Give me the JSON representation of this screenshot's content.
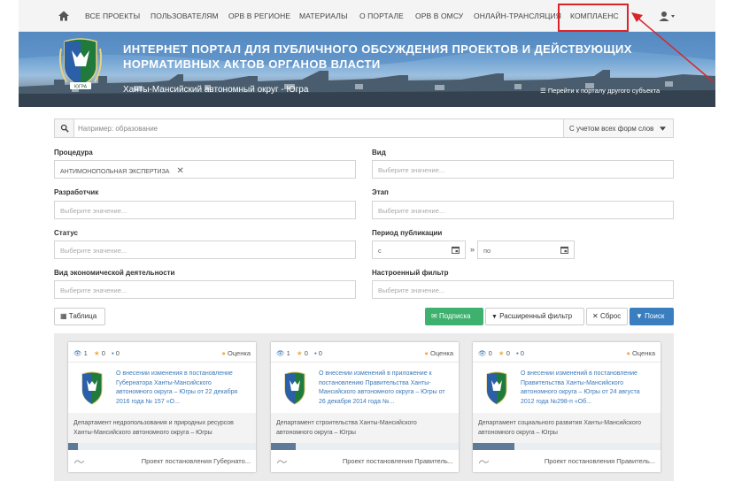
{
  "nav": {
    "home_icon": "home-icon",
    "items": [
      "ВСЕ ПРОЕКТЫ",
      "ПОЛЬЗОВАТЕЛЯМ",
      "ОРВ В РЕГИОНЕ",
      "МАТЕРИАЛЫ",
      "О ПОРТАЛЕ",
      "ОРВ В ОМСУ",
      "ОНЛАЙН-ТРАНСЛЯЦИЯ",
      "КОМПЛАЕНС"
    ],
    "user_icon": "user-icon"
  },
  "banner": {
    "title": "ИНТЕРНЕТ ПОРТАЛ ДЛЯ ПУБЛИЧНОГО ОБСУЖДЕНИЯ ПРОЕКТОВ И ДЕЙСТВУЮЩИХ НОРМАТИВНЫХ АКТОВ ОРГАНОВ ВЛАСТИ",
    "subtitle": "Ханты-Мансийский автономный округ - Югра",
    "link": "Перейти к порталу другого субъекта",
    "logo_text": "ЮГРА"
  },
  "search": {
    "placeholder": "Например: образование",
    "mode": "С учетом всех форм слов"
  },
  "filters": {
    "procedure_label": "Процедура",
    "procedure_tag": "АНТИМОНОПОЛЬНАЯ ЭКСПЕРТИЗА",
    "kind_label": "Вид",
    "developer_label": "Разработчик",
    "stage_label": "Этап",
    "status_label": "Статус",
    "period_label": "Период публикации",
    "date_from": "с",
    "date_to": "по",
    "activity_label": "Вид экономической деятельности",
    "custom_filter_label": "Настроенный фильтр",
    "placeholder": "Выберите значение..."
  },
  "buttons": {
    "table": "Таблица",
    "subscribe": "Подписка",
    "advanced": "Расширенный фильтр",
    "reset": "Сброс",
    "search": "Поиск"
  },
  "colors": {
    "subscribe": "#3fb16f",
    "search": "#3a7ebf",
    "highlight": "#d9252a",
    "link": "#3b78b9"
  },
  "cards": [
    {
      "views": "1",
      "stars": "0",
      "comments": "0",
      "rating": "Оценка",
      "title": "О внесении изменения в постановление Губернатора Ханты-Мансийского автономного округа – Югры от 22 декабря 2016 года № 157 «О...",
      "dept": "Департамент недропользования и природных ресурсов Ханты-Мансийского автономного округа – Югры",
      "progress": 0.05,
      "type": "Проект постановления Губернато..."
    },
    {
      "views": "1",
      "stars": "0",
      "comments": "0",
      "rating": "Оценка",
      "title": "О внесении изменений в приложение к постановлению Правительства Ханты-Мансийского автономного округа – Югры от 26 декабря 2014 года №...",
      "dept": "Департамент строительства Ханты-Мансийского автономного округа – Югры",
      "progress": 0.13,
      "type": "Проект постановления Правитель..."
    },
    {
      "views": "0",
      "stars": "0",
      "comments": "0",
      "rating": "Оценка",
      "title": "О внесении изменений в постановление Правительства Ханты-Мансийского автономного округа – Югры от 24 августа 2012 года №298-п «Об...",
      "dept": "Департамент социального развития Ханты-Мансийского автономного округа – Югры",
      "progress": 0.22,
      "type": "Проект постановления Правитель..."
    }
  ]
}
